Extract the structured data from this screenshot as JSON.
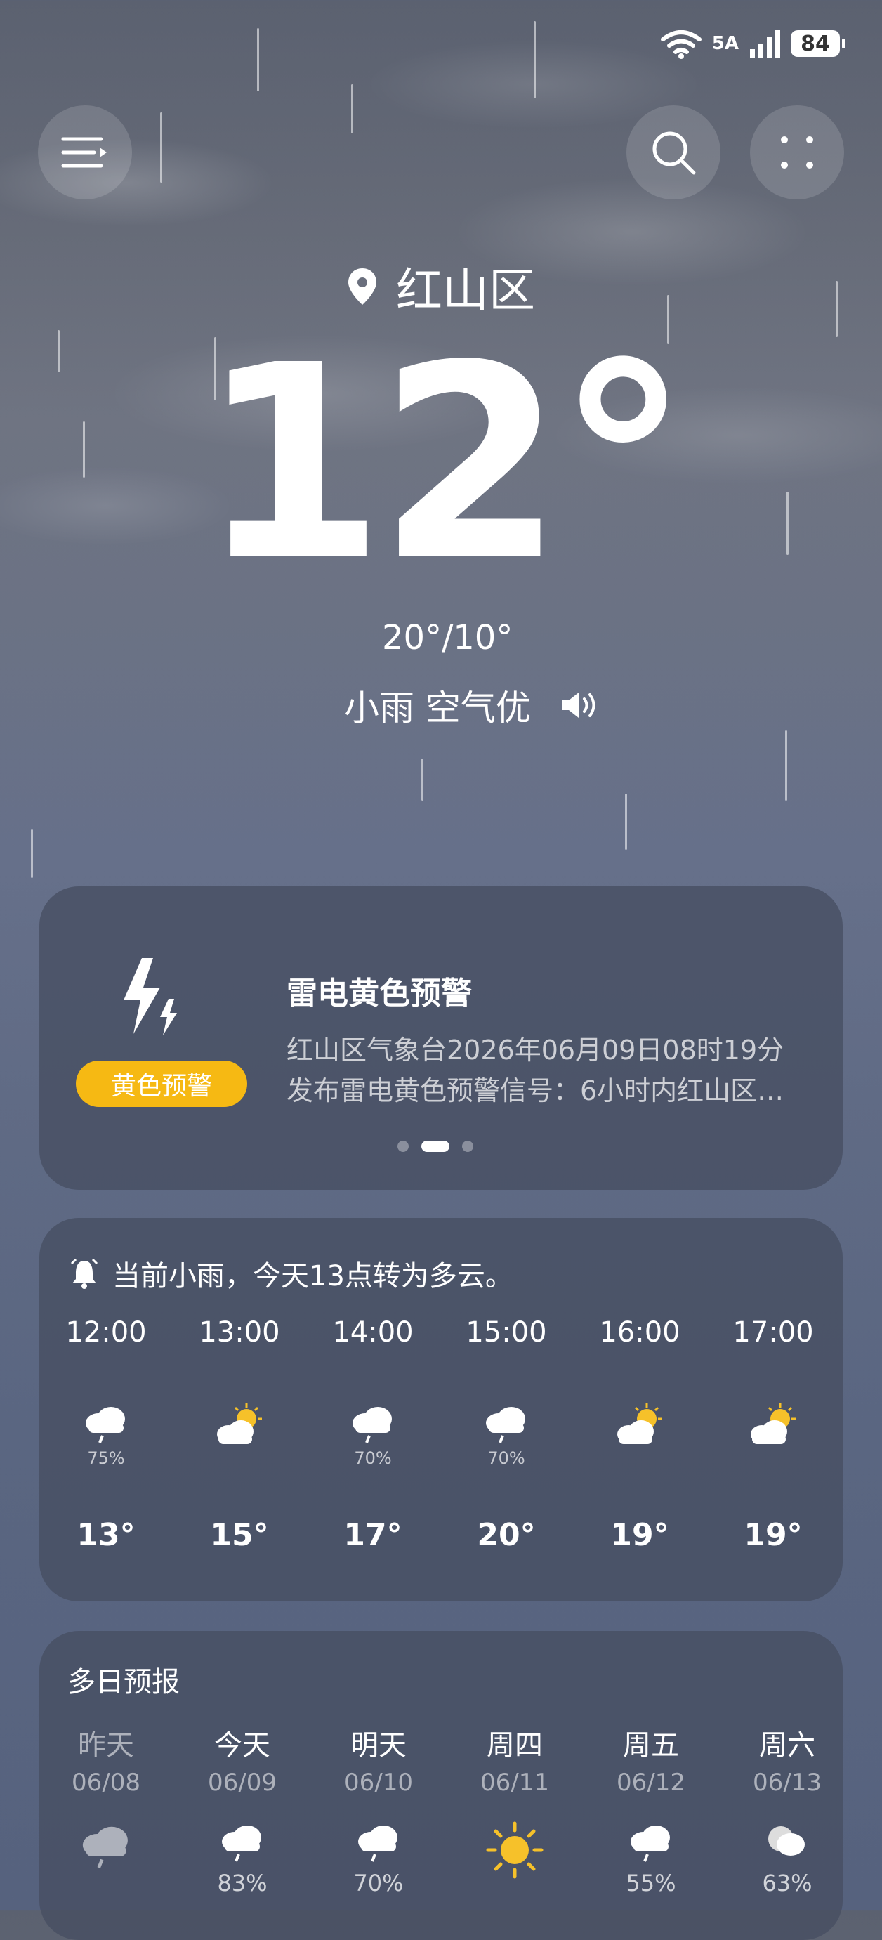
{
  "status": {
    "network": "5A",
    "battery": "84"
  },
  "header": {
    "location": "红山区"
  },
  "current": {
    "temp": "12°",
    "range": "20°/10°",
    "condition": "小雨 空气优"
  },
  "warning": {
    "badge": "黄色预警",
    "title": "雷电黄色预警",
    "line1": "红山区气象台2026年06月09日08时19分",
    "line2": "发布雷电黄色预警信号：6小时内红山区…",
    "badge_color": "#f6b913"
  },
  "hourly": {
    "summary": "当前小雨，今天13点转为多云。",
    "items": [
      {
        "time": "12:00",
        "icon": "rain-cloud-icon",
        "pop": "75%",
        "temp": "13°"
      },
      {
        "time": "13:00",
        "icon": "sun-cloud-icon",
        "pop": "",
        "temp": "15°"
      },
      {
        "time": "14:00",
        "icon": "rain-cloud-icon",
        "pop": "70%",
        "temp": "17°"
      },
      {
        "time": "15:00",
        "icon": "rain-cloud-icon",
        "pop": "70%",
        "temp": "20°"
      },
      {
        "time": "16:00",
        "icon": "sun-cloud-icon",
        "pop": "",
        "temp": "19°"
      },
      {
        "time": "17:00",
        "icon": "sun-cloud-icon",
        "pop": "",
        "temp": "19°"
      }
    ]
  },
  "daily": {
    "title": "多日预报",
    "items": [
      {
        "name": "昨天",
        "date": "06/08",
        "icon": "rain-cloud-icon",
        "pop": ""
      },
      {
        "name": "今天",
        "date": "06/09",
        "icon": "rain-cloud-icon",
        "pop": "83%"
      },
      {
        "name": "明天",
        "date": "06/10",
        "icon": "rain-cloud-icon",
        "pop": "70%"
      },
      {
        "name": "周四",
        "date": "06/11",
        "icon": "sun-icon",
        "pop": ""
      },
      {
        "name": "周五",
        "date": "06/12",
        "icon": "rain-cloud-icon",
        "pop": "55%"
      },
      {
        "name": "周六",
        "date": "06/13",
        "icon": "moon-cloud-icon",
        "pop": "63%"
      }
    ]
  }
}
